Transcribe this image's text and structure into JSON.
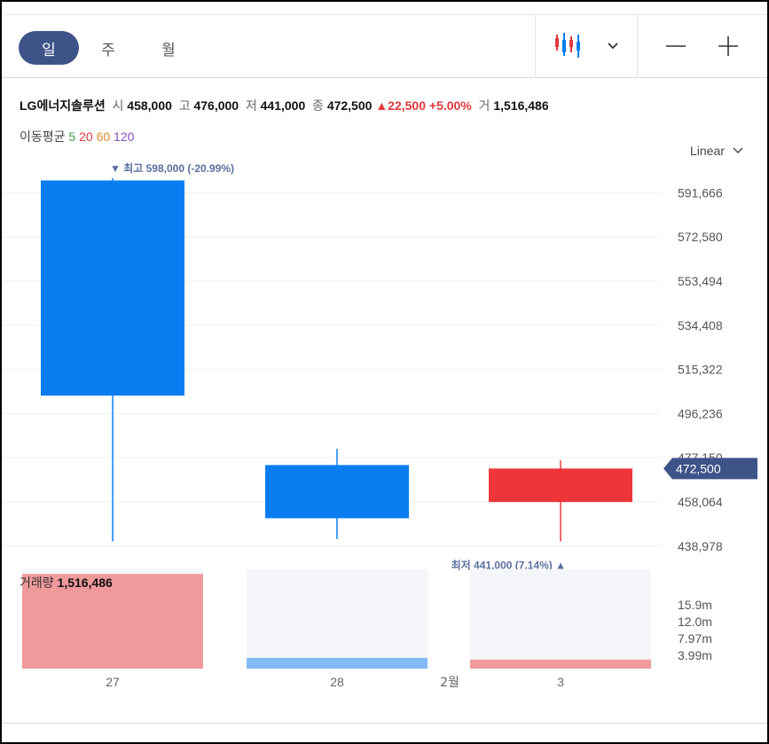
{
  "tabs": [
    "일",
    "주",
    "월"
  ],
  "active_tab": 0,
  "quote": {
    "name": "LG에너지솔루션",
    "open_label": "시",
    "open": "458,000",
    "high_label": "고",
    "high": "476,000",
    "low_label": "저",
    "low": "441,000",
    "close_label": "종",
    "close": "472,500",
    "change": "22,500",
    "change_pct": "+5.00%",
    "volume_label": "거",
    "volume": "1,516,486"
  },
  "moving_avg": {
    "label": "이동평균",
    "periods": [
      "5",
      "20",
      "60",
      "120"
    ],
    "colors": [
      "#3aa34a",
      "#e0393e",
      "#e08a2e",
      "#8a4fc7"
    ]
  },
  "scale_toggle": "Linear",
  "colors": {
    "up": "#ee363a",
    "down": "#0a7ef0",
    "accent": "#3e5489",
    "vol_up": "#f09a9c",
    "vol_down": "#84baf5",
    "marker": "#5a6fa0"
  },
  "chart_data": {
    "type": "candlestick",
    "categories": [
      "27",
      "28",
      "3"
    ],
    "month_label": "2월",
    "open": [
      504000,
      474000,
      458000
    ],
    "high": [
      598000,
      481000,
      476000
    ],
    "low": [
      441000,
      442000,
      441000
    ],
    "close": [
      597000,
      451000,
      472500
    ],
    "direction": [
      "down",
      "down",
      "up"
    ],
    "volume": [
      15900000,
      1800000,
      1516486
    ],
    "y_ticks": [
      "591,666",
      "572,580",
      "553,494",
      "534,408",
      "515,322",
      "496,236",
      "477,150",
      "458,064",
      "438,978"
    ],
    "y_tick_values": [
      591666,
      572580,
      553494,
      534408,
      515322,
      496236,
      477150,
      458064,
      438978
    ],
    "ylim": [
      432000,
      606000
    ],
    "volume_ticks": [
      "15.9m",
      "12.0m",
      "7.97m",
      "3.99m"
    ],
    "volume_label": "거래량",
    "volume_value": "1,516,486",
    "current_price": "472,500",
    "current_value": 472500,
    "max_label": "최고",
    "max_value": "598,000 (-20.99%)",
    "min_label": "최저",
    "min_value": "441,000 (7.14%)"
  }
}
